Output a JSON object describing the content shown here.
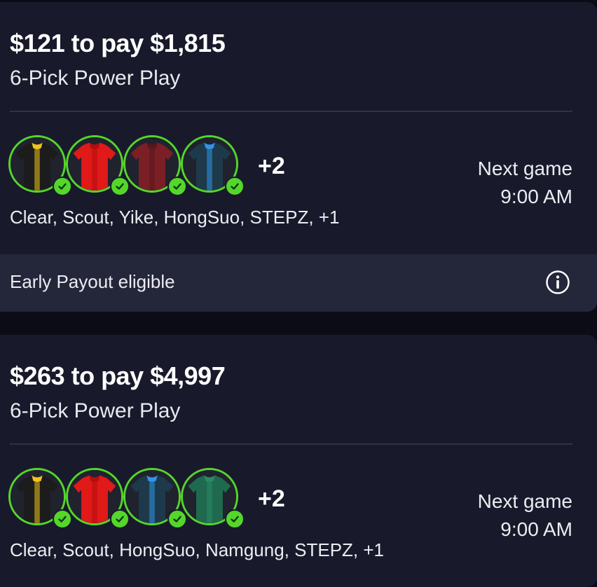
{
  "cards": [
    {
      "title": "$121 to pay $1,815",
      "subtitle": "6-Pick Power Play",
      "avatars": [
        {
          "icon": "jersey-black-yellow-icon",
          "jersey_color": "#1c1c1c",
          "accent": "#f0c419"
        },
        {
          "icon": "jersey-red-icon",
          "jersey_color": "#e01919",
          "accent": "#b40d0d"
        },
        {
          "icon": "jersey-maroon-icon",
          "jersey_color": "#7a1f26",
          "accent": "#5a161b"
        },
        {
          "icon": "jersey-blue-dark-icon",
          "jersey_color": "#1e3a4a",
          "accent": "#2f95e8"
        }
      ],
      "more_count": "+2",
      "next_game_label": "Next game",
      "next_game_time": "9:00 AM",
      "players": "Clear, Scout, Yike, HongSuo, STEPZ, +1",
      "early_payout": "Early Payout eligible"
    },
    {
      "title": "$263 to pay $4,997",
      "subtitle": "6-Pick Power Play",
      "avatars": [
        {
          "icon": "jersey-black-yellow-icon",
          "jersey_color": "#1c1c1c",
          "accent": "#f0c419"
        },
        {
          "icon": "jersey-red-icon",
          "jersey_color": "#e01919",
          "accent": "#b40d0d"
        },
        {
          "icon": "jersey-blue-dark-icon",
          "jersey_color": "#1e3a4a",
          "accent": "#2f95e8"
        },
        {
          "icon": "jersey-green-icon",
          "jersey_color": "#1f6a4e",
          "accent": "#2a8a64"
        }
      ],
      "more_count": "+2",
      "next_game_label": "Next game",
      "next_game_time": "9:00 AM",
      "players": "Clear, Scout, HongSuo, Namgung, STEPZ, +1"
    }
  ],
  "colors": {
    "background": "#0b0c16",
    "card": "#181a2b",
    "early_bar": "#24263a",
    "check_green": "#55d62b"
  }
}
